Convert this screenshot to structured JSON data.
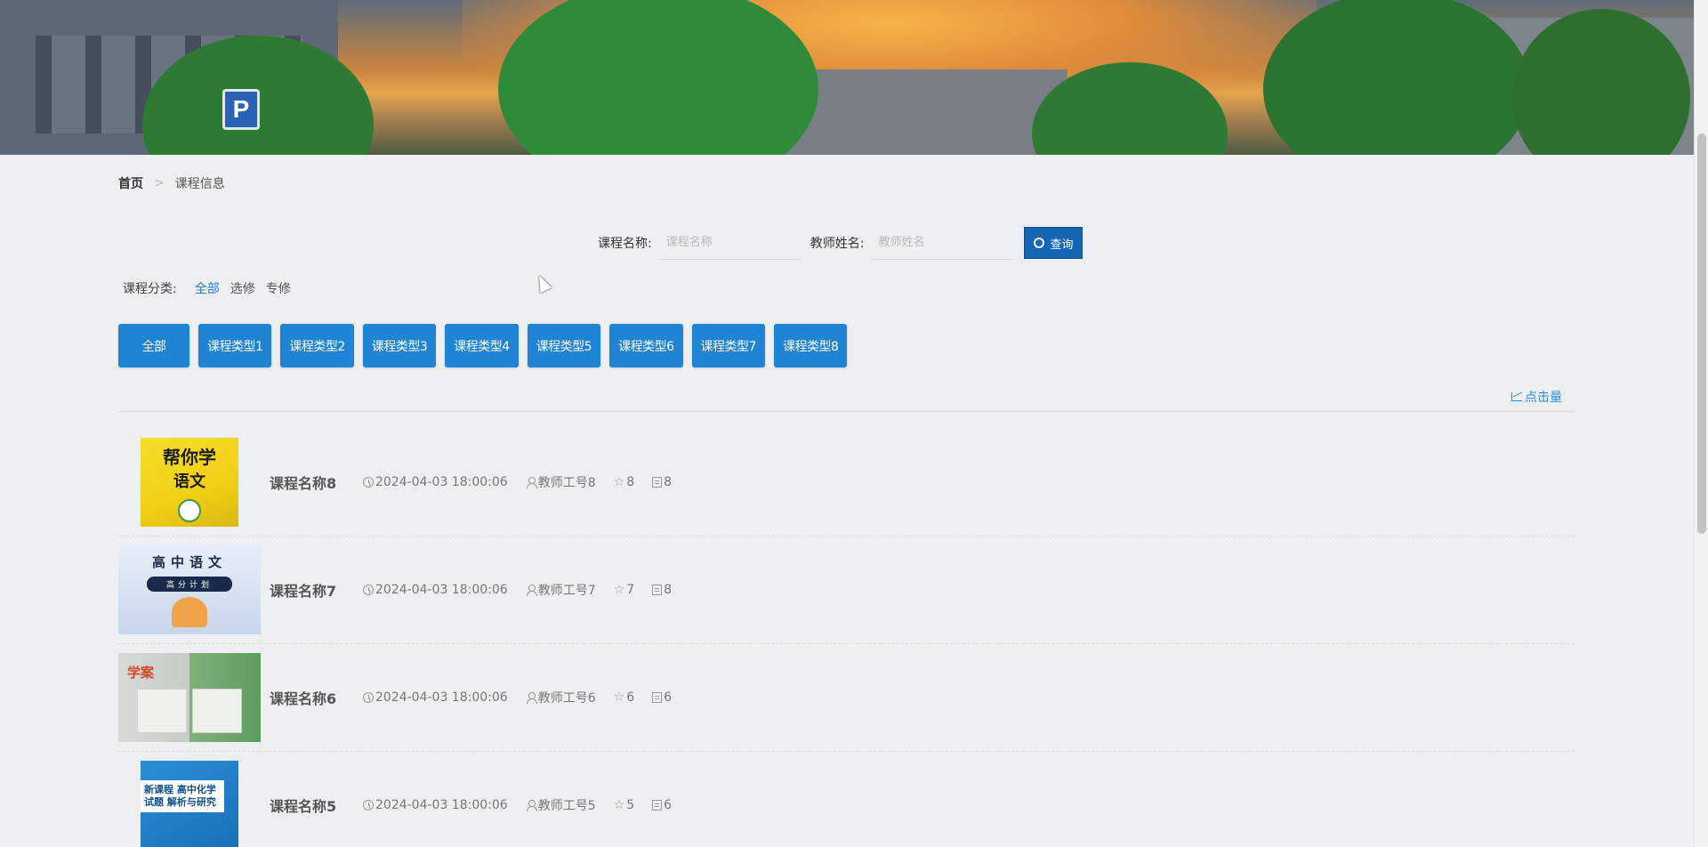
{
  "breadcrumb": {
    "home": "首页",
    "separator": ">",
    "current": "课程信息"
  },
  "search": {
    "course_label": "课程名称:",
    "course_placeholder": "课程名称",
    "teacher_label": "教师姓名:",
    "teacher_placeholder": "教师姓名",
    "button_label": "查询"
  },
  "category": {
    "label": "课程分类:",
    "options": [
      "全部",
      "选修",
      "专修"
    ],
    "active": "全部"
  },
  "types": [
    "全部",
    "课程类型1",
    "课程类型2",
    "课程类型3",
    "课程类型4",
    "课程类型5",
    "课程类型6",
    "课程类型7",
    "课程类型8"
  ],
  "sort": {
    "label": "点击量"
  },
  "courses": [
    {
      "title": "课程名称8",
      "time": "2024-04-03 18:00:06",
      "teacher": "教师工号8",
      "stars": "8",
      "count": "8",
      "cover_text": "帮你学",
      "cover_sub": "语文"
    },
    {
      "title": "课程名称7",
      "time": "2024-04-03 18:00:06",
      "teacher": "教师工号7",
      "stars": "7",
      "count": "8",
      "cover_text": "高中语文",
      "cover_sub": "高分计划"
    },
    {
      "title": "课程名称6",
      "time": "2024-04-03 18:00:06",
      "teacher": "教师工号6",
      "stars": "6",
      "count": "6",
      "cover_text": "学案"
    },
    {
      "title": "课程名称5",
      "time": "2024-04-03 18:00:06",
      "teacher": "教师工号5",
      "stars": "5",
      "count": "6",
      "cover_text": "新课程 高中化学试题 解析与研究"
    }
  ],
  "banner": {
    "sign": "P"
  },
  "colors": {
    "primary": "#1f84d4",
    "search_button": "#1565b5",
    "link": "#2b8ad6",
    "active_category": "#1c7ed6"
  }
}
